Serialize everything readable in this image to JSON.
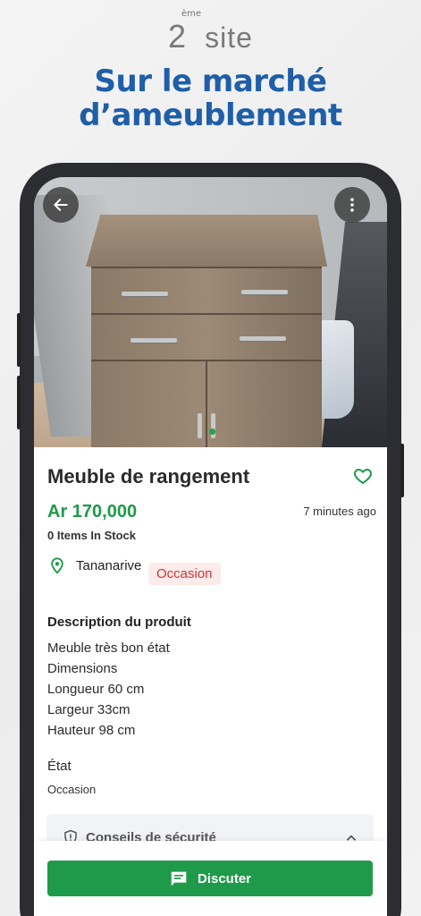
{
  "promo": {
    "rank_number": "2",
    "rank_suffix": "ème",
    "rank_word": "site",
    "title_line1": "Sur le marché",
    "title_line2": "d’ameublement"
  },
  "listing": {
    "title": "Meuble de rangement",
    "price": "Ar 170,000",
    "posted": "7 minutes ago",
    "stock": "0 Items In Stock",
    "location": "Tananarive",
    "condition_badge": "Occasion",
    "description_heading": "Description du produit",
    "description_lines": [
      "Meuble très bon état",
      "Dimensions",
      "Longueur 60 cm",
      "Largeur 33cm",
      "Hauteur 98 cm"
    ],
    "state_heading": "État",
    "state_value": "Occasion",
    "safety_label": "Conseils de sécurité"
  },
  "actions": {
    "chat_label": "Discuter"
  },
  "icons": {
    "back": "arrow-left-icon",
    "menu": "more-vert-icon",
    "favorite": "heart-outline-icon",
    "location": "location-pin-icon",
    "chat": "chat-bubble-icon",
    "shield": "shield-icon",
    "chevron": "chevron-up-icon"
  },
  "colors": {
    "brand_blue": "#1f5ea8",
    "accent_green": "#1f9a4b",
    "badge_bg": "#fdeaea",
    "badge_text": "#c33939"
  }
}
